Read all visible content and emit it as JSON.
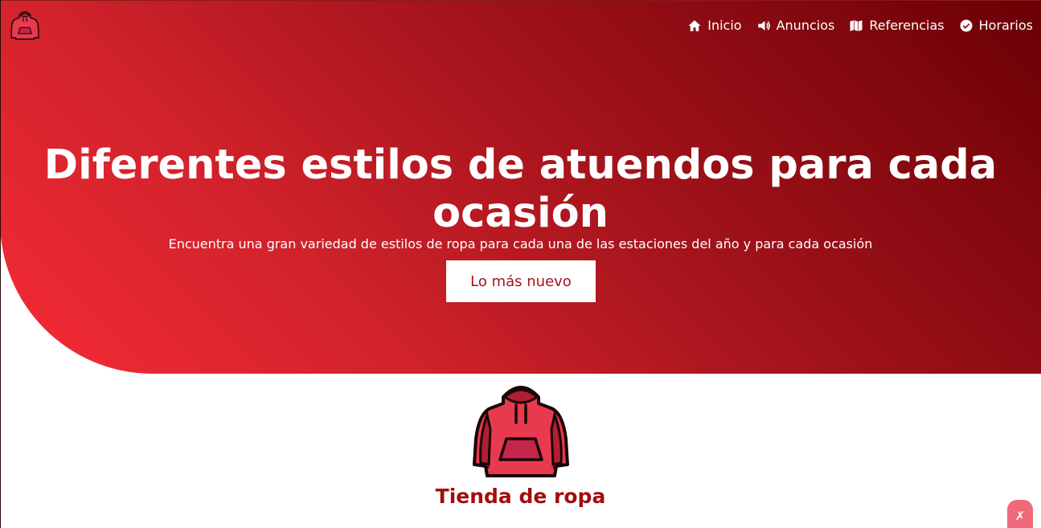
{
  "nav": {
    "items": [
      {
        "label": "Inicio",
        "icon": "home-icon"
      },
      {
        "label": "Anuncios",
        "icon": "megaphone-icon"
      },
      {
        "label": "Referencias",
        "icon": "map-icon"
      },
      {
        "label": "Horarios",
        "icon": "check-circle-icon"
      }
    ]
  },
  "hero": {
    "headline": "Diferentes estilos de atuendos para cada ocasión",
    "subtitle": "Encuentra una gran variedad de estilos de ropa para cada una de las estaciones del año y para cada ocasión",
    "cta_label": "Lo más nuevo"
  },
  "store": {
    "title": "Tienda de ropa"
  },
  "colors": {
    "hero_dark": "#6b0005",
    "hero_light": "#f52b35",
    "title_red": "#a30d0d",
    "hoodie_red": "#e83a4f"
  }
}
